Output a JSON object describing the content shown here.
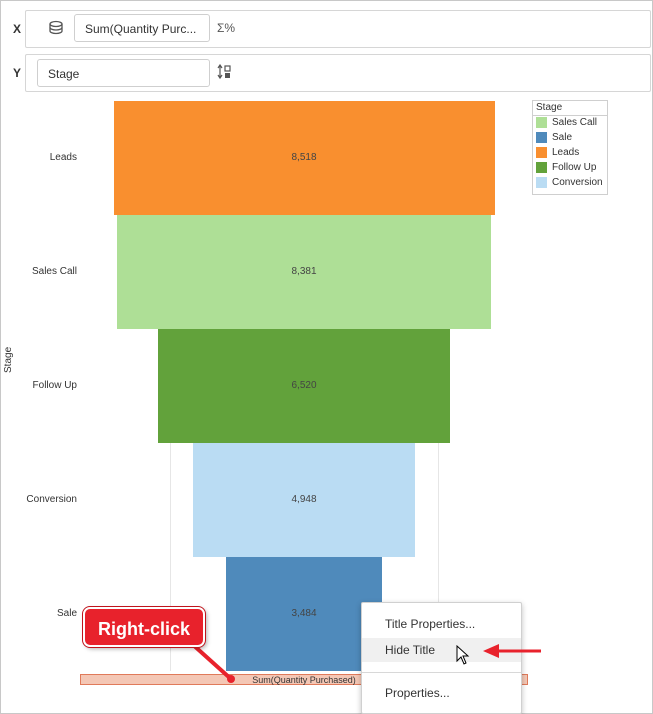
{
  "shelves": {
    "x": {
      "label": "X",
      "pill": "Sum(Quantity Purc...",
      "icon": "database-icon",
      "aggregate_icon": "Σ%"
    },
    "y": {
      "label": "Y",
      "pill": "Stage",
      "icon": "sort-icon"
    }
  },
  "chart_data": {
    "type": "bar",
    "orientation": "horizontal-funnel",
    "categories": [
      "Leads",
      "Sales Call",
      "Follow Up",
      "Conversion",
      "Sale"
    ],
    "values": [
      8518,
      8381,
      6520,
      4948,
      3484
    ],
    "value_labels": [
      "8,518",
      "8,381",
      "6,520",
      "4,948",
      "3,484"
    ],
    "colors": [
      "#f98f2f",
      "#aedf96",
      "#62a23b",
      "#badcf3",
      "#4f8abb"
    ],
    "ylabel": "Stage",
    "xlabel": "Sum(Quantity Purchased)",
    "grid": true,
    "legend": {
      "title": "Stage",
      "placement": "right",
      "items": [
        {
          "label": "Sales Call",
          "color": "#aedf96"
        },
        {
          "label": "Sale",
          "color": "#4f8abb"
        },
        {
          "label": "Leads",
          "color": "#f98f2f"
        },
        {
          "label": "Follow Up",
          "color": "#62a23b"
        },
        {
          "label": "Conversion",
          "color": "#badcf3"
        }
      ]
    }
  },
  "context_menu": {
    "items": [
      "Title Properties...",
      "Hide Title",
      "Properties..."
    ],
    "hovered": "Hide Title"
  },
  "callout": {
    "text": "Right-click",
    "color": "#e8222c"
  }
}
